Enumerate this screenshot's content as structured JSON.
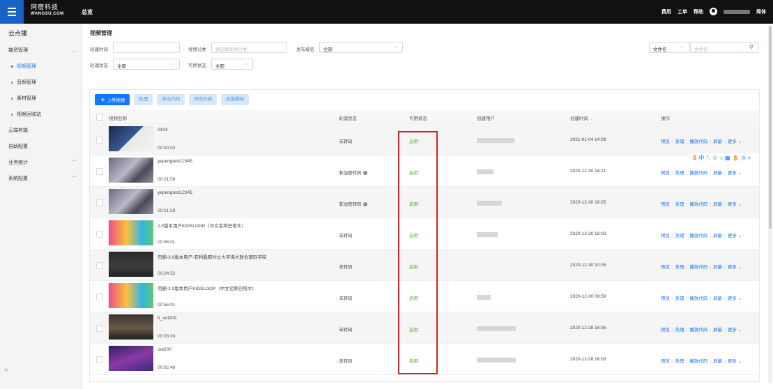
{
  "header": {
    "logo_cn": "网宿科技",
    "logo_en": "WANGSU.COM",
    "overview": "总览",
    "right_items": [
      "费用",
      "工单",
      "帮助"
    ],
    "lang": "简体"
  },
  "sidebar": {
    "title": "云点播",
    "groups": [
      {
        "label": "媒资管理",
        "expanded": true
      },
      {
        "label": "云端剪辑"
      },
      {
        "label": "自助配置"
      },
      {
        "label": "业务统计"
      },
      {
        "label": "系统配置"
      }
    ],
    "subitems": [
      "视频管理",
      "音频管理",
      "素材管理",
      "视频回收站"
    ],
    "collapse_icon": "«"
  },
  "filters": {
    "page_title": "视频管理",
    "create_time_label": "创建时间",
    "category_label": "视频分类",
    "category_placeholder": "请选择视频分类",
    "domain_label": "发布域名",
    "domain_value": "全部",
    "process_label": "处理状态",
    "process_value": "全部",
    "avail_label": "可用状态",
    "avail_value": "全部",
    "search_type": "文件名",
    "search_placeholder": "文件名"
  },
  "toolbar": {
    "upload": "上传视频",
    "process": "处理",
    "export": "导出代码",
    "modify_category": "修改分类",
    "batch_delete": "批量删除"
  },
  "table": {
    "columns": [
      "视频名称",
      "处理状态",
      "可用状态",
      "创建用户",
      "创建时间",
      "操作"
    ],
    "ops": [
      "预览",
      "处理",
      "播放代码",
      "屏蔽",
      "更多"
    ],
    "rows": [
      {
        "name": "0104",
        "duration": "00:00:03",
        "process": "未转码",
        "available": "启用",
        "time": "2021-01-04 14:08"
      },
      {
        "name": "yepengtest12345",
        "duration": "00:01:59",
        "process": "非加密转码",
        "available": "启用",
        "time": "2020-12-30 18:21"
      },
      {
        "name": "yepengtest12345",
        "duration": "00:01:59",
        "process": "非加密转码",
        "available": "启用",
        "time": "2020-12-30 18:05"
      },
      {
        "name": "2.0版本用户KIDSLOOP（中文名称巴塔木）",
        "duration": "00:56:01",
        "process": "未转码",
        "available": "启用",
        "time": "2020-12-30 18:03"
      },
      {
        "name": "勿删-3.0版本用户-亚利桑那州立大学海大联合国际学院",
        "duration": "00:24:52",
        "process": "未转码",
        "available": "启用",
        "time": "2020-12-30 10:05"
      },
      {
        "name": "勿删-2.0版本用户KIDSLOOP（中文名称巴塔木）",
        "duration": "00:56:01",
        "process": "未转码",
        "available": "启用",
        "time": "2020-12-30 09:59"
      },
      {
        "name": "b_out200",
        "duration": "00:03:03",
        "process": "未转码",
        "available": "启用",
        "time": "2020-12-28 16:06"
      },
      {
        "name": "out200",
        "duration": "00:02:48",
        "process": "未转码",
        "available": "启用",
        "time": "2020-12-28 16:03"
      }
    ]
  },
  "ime": {
    "logo": "S",
    "lang": "中"
  }
}
